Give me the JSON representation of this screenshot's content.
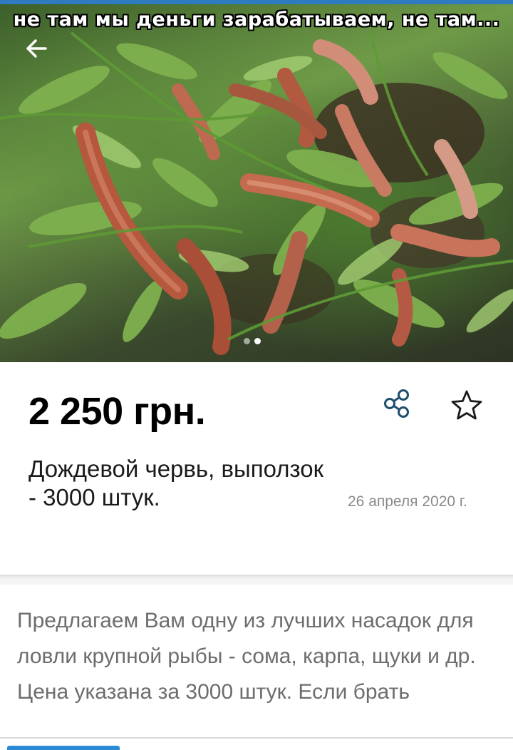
{
  "meme": {
    "caption": "не там мы деньги зарабатываем, не там..."
  },
  "gallery": {
    "image_count": 2,
    "active_index": 1
  },
  "listing": {
    "price": "2 250 грн.",
    "title": "Дождевой червь, выползок - 3000 штук.",
    "date": "26 апреля 2020 г."
  },
  "description": {
    "line1": "Предлагаем Вам одну из лучших насадок для ловли крупной рыбы - сома, карпа, щуки и др.",
    "line2": "Цена указана за 3000 штук. Если брать"
  },
  "icons": {
    "back": "arrow-left-icon",
    "share": "share-icon",
    "favorite": "star-outline-icon"
  },
  "colors": {
    "accent": "#2a8ad4",
    "price_text": "#000000",
    "muted_text": "#8a8a8a",
    "description_text": "#6d6d6d"
  }
}
